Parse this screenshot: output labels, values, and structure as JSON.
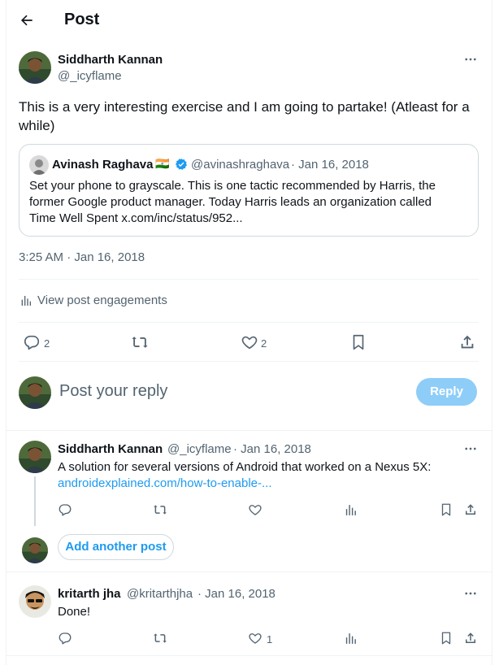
{
  "header": {
    "title": "Post"
  },
  "main_post": {
    "author_name": "Siddharth Kannan",
    "author_handle": "@_icyflame",
    "text": "This is a very interesting exercise and I am going to partake! (Atleast for a while)",
    "quote": {
      "author_name": "Avinash Raghava",
      "flag": "🇮🇳",
      "author_handle": "@avinashraghava",
      "date": "· Jan 16, 2018",
      "text": "Set your phone to grayscale. This is one tactic recommended by Harris, the former Google product manager. Today Harris leads an organization called Time Well Spent x.com/inc/status/952..."
    },
    "timestamp": "3:25 AM · Jan 16, 2018",
    "engagements_label": "View post engagements",
    "actions": {
      "replies": "2",
      "likes": "2"
    }
  },
  "reply_composer": {
    "placeholder": "Post your reply",
    "button_label": "Reply"
  },
  "thread_reply": {
    "author_name": "Siddharth Kannan",
    "author_handle": "@_icyflame",
    "date": "· Jan 16, 2018",
    "text": "A solution for several versions of Android that worked on a Nexus 5X:",
    "link": "androidexplained.com/how-to-enable-..."
  },
  "add_post": {
    "label": "Add another post"
  },
  "reply2": {
    "author_name": "kritarth jha",
    "author_handle": "@kritarthjha",
    "date": "· Jan 16, 2018",
    "text": "Done!",
    "likes": "1"
  },
  "colors": {
    "accent": "#1d9bf0",
    "reply_button_disabled": "#8ecdf8",
    "text_secondary": "#536471",
    "divider": "#eff3f4"
  }
}
